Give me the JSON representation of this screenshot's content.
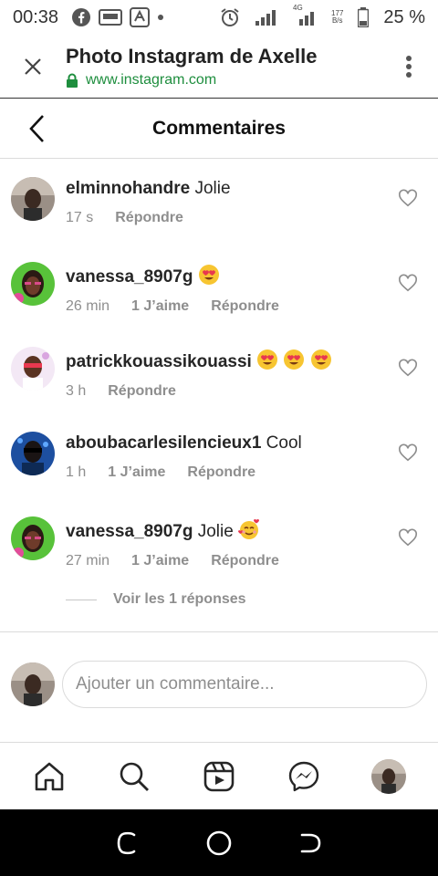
{
  "status_bar": {
    "time": "00:38",
    "net_speed_top": "177",
    "net_speed_bottom": "B/s",
    "network_type": "4G",
    "battery_pct": "25 %"
  },
  "browser": {
    "title": "Photo Instagram de Axelle",
    "url": "www.instagram.com"
  },
  "header": {
    "title": "Commentaires"
  },
  "comments": [
    {
      "username": "elminnohandre",
      "text": "Jolie",
      "time": "17 s",
      "likes": "",
      "reply": "Répondre",
      "emoji_count": 0,
      "emoji": ""
    },
    {
      "username": "vanessa_8907g",
      "text": "",
      "time": "26 min",
      "likes": "1 J’aime",
      "reply": "Répondre",
      "emoji_count": 1,
      "emoji": "heart-eyes"
    },
    {
      "username": "patrickkouassikouassi",
      "text": "",
      "time": "3 h",
      "likes": "",
      "reply": "Répondre",
      "emoji_count": 3,
      "emoji": "heart-eyes"
    },
    {
      "username": "aboubacarlesilencieux1",
      "text": "Cool",
      "time": "1 h",
      "likes": "1 J’aime",
      "reply": "Répondre",
      "emoji_count": 0,
      "emoji": ""
    },
    {
      "username": "vanessa_8907g",
      "text": "Jolie",
      "time": "27 min",
      "likes": "1 J’aime",
      "reply": "Répondre",
      "emoji_count": 1,
      "emoji": "smiling-hearts"
    }
  ],
  "view_replies": "Voir les 1 réponses",
  "add_comment": {
    "placeholder": "Ajouter un commentaire..."
  },
  "colors": {
    "text": "#262626",
    "secondary": "#8e8e8e",
    "divider": "#dbdbdb",
    "url_green": "#1e8e3e",
    "emoji_yellow": "#f7c531",
    "emoji_heart": "#e8384f"
  },
  "icons": [
    "facebook-icon",
    "ssd-blast-icon",
    "translate-icon",
    "alarm-icon",
    "signal-icon",
    "battery-icon",
    "close-icon",
    "lock-icon",
    "more-vertical-icon",
    "back-chevron-icon",
    "heart-outline-icon",
    "home-icon",
    "search-icon",
    "reels-icon",
    "messenger-icon"
  ]
}
